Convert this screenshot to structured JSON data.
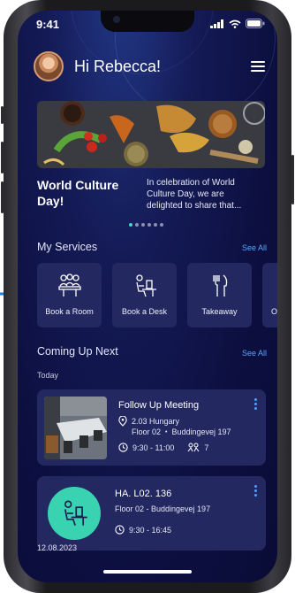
{
  "status_bar": {
    "time": "9:41"
  },
  "header": {
    "greeting": "Hi Rebecca!"
  },
  "banner": {
    "title": "World Culture Day!",
    "text": "In celebration of World Culture Day, we are delighted to share that...",
    "page_count": 6,
    "active_page": 1
  },
  "services": {
    "title": "My Services",
    "see_all": "See All",
    "items": [
      {
        "label": "Book a Room",
        "icon": "meeting-room-icon"
      },
      {
        "label": "Book a Desk",
        "icon": "desk-icon"
      },
      {
        "label": "Takeaway",
        "icon": "takeaway-icon"
      },
      {
        "label": "Or",
        "icon": "order-icon"
      }
    ]
  },
  "upcoming": {
    "title": "Coming Up Next",
    "see_all": "See All",
    "day_label": "Today",
    "meeting": {
      "title": "Follow Up Meeting",
      "room": "2.03 Hungary",
      "floor": "Floor 02",
      "address": "Buddingevej 197",
      "time": "9:30 - 11:00",
      "attendees": "7"
    },
    "desk": {
      "title": "HA. L02. 136",
      "location": "Floor 02 - Buddingevej 197",
      "time": "9:30 - 16:45"
    },
    "next_date": "12.08.2023"
  },
  "colors": {
    "background": "#0c0f3f",
    "card": "#232860",
    "accent": "#3ad3b2",
    "link": "#5aa6ff",
    "pointer": "#1f7be8"
  }
}
